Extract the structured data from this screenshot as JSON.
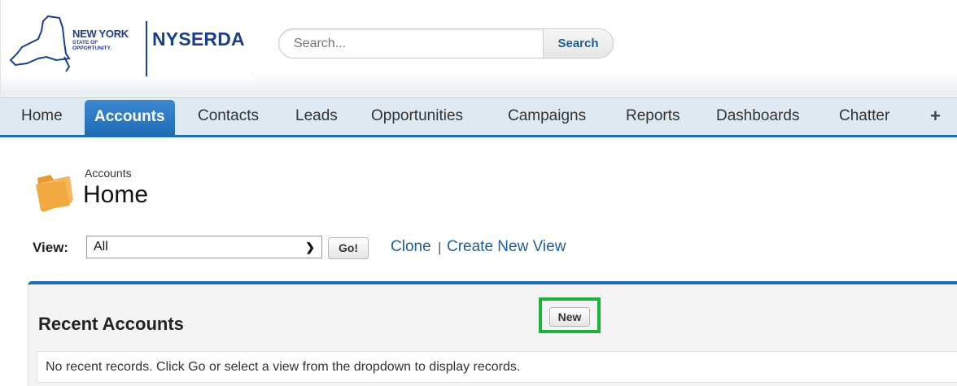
{
  "logo": {
    "state_name": "NEW YORK",
    "state_tagline": "STATE OF OPPORTUNITY.",
    "org_name": "NYSERDA"
  },
  "search": {
    "placeholder": "Search...",
    "button_label": "Search"
  },
  "tabs": [
    {
      "label": "Home",
      "active": false
    },
    {
      "label": "Accounts",
      "active": true
    },
    {
      "label": "Contacts",
      "active": false
    },
    {
      "label": "Leads",
      "active": false
    },
    {
      "label": "Opportunities",
      "active": false
    },
    {
      "label": "Campaigns",
      "active": false
    },
    {
      "label": "Reports",
      "active": false
    },
    {
      "label": "Dashboards",
      "active": false
    },
    {
      "label": "Chatter",
      "active": false
    }
  ],
  "more_tabs_symbol": "+",
  "page": {
    "breadcrumb": "Accounts",
    "title": "Home",
    "icon": "folder-icon"
  },
  "view": {
    "label": "View:",
    "selected": "All",
    "go_label": "Go!",
    "clone_label": "Clone",
    "separator": "|",
    "create_label": "Create New View"
  },
  "recent": {
    "title": "Recent Accounts",
    "new_label": "New",
    "empty_message": "No recent records. Click Go or select a view from the dropdown to display records."
  },
  "colors": {
    "accent": "#1f6cb5",
    "link": "#1f5f99",
    "highlight": "#20b040",
    "brand": "#1c3f8c"
  }
}
